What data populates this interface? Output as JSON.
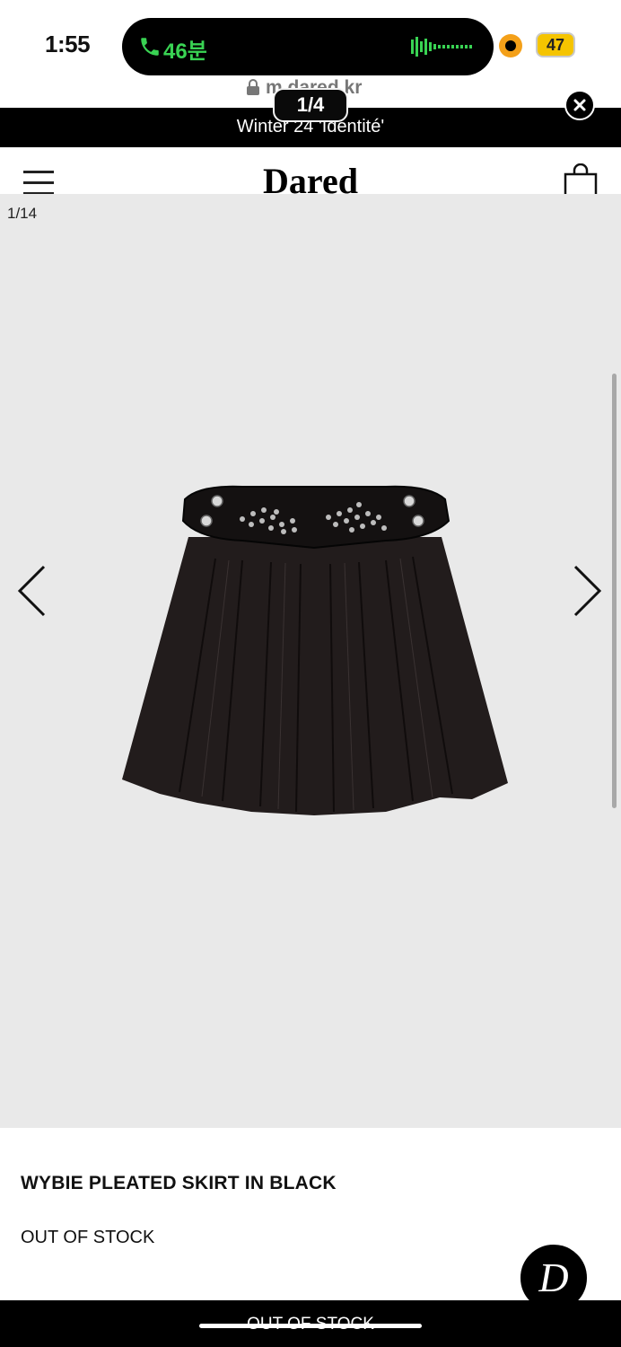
{
  "status_bar": {
    "time": "1:55",
    "call_duration": "46분",
    "battery": "47",
    "url": "m.dared.kr",
    "page_indicator": "1/4"
  },
  "announcement": {
    "text": "Winter 24 'Identité'"
  },
  "header": {
    "brand": "Dared"
  },
  "gallery": {
    "counter": "1/14"
  },
  "product": {
    "name": "WYBIE PLEATED SKIRT IN BLACK",
    "stock": "OUT OF STOCK"
  },
  "chat": {
    "monogram": "D"
  },
  "bottom_bar": {
    "label": "OUT OF STOCK"
  },
  "colors": {
    "call_green": "#39d353",
    "battery_yellow": "#f5c400",
    "gallery_bg": "#e9e9e9"
  },
  "icons": [
    "phone-icon",
    "waveform-icon",
    "lock-icon",
    "close-icon",
    "menu-icon",
    "shopping-bag-icon",
    "chevron-left-icon",
    "chevron-right-icon"
  ]
}
